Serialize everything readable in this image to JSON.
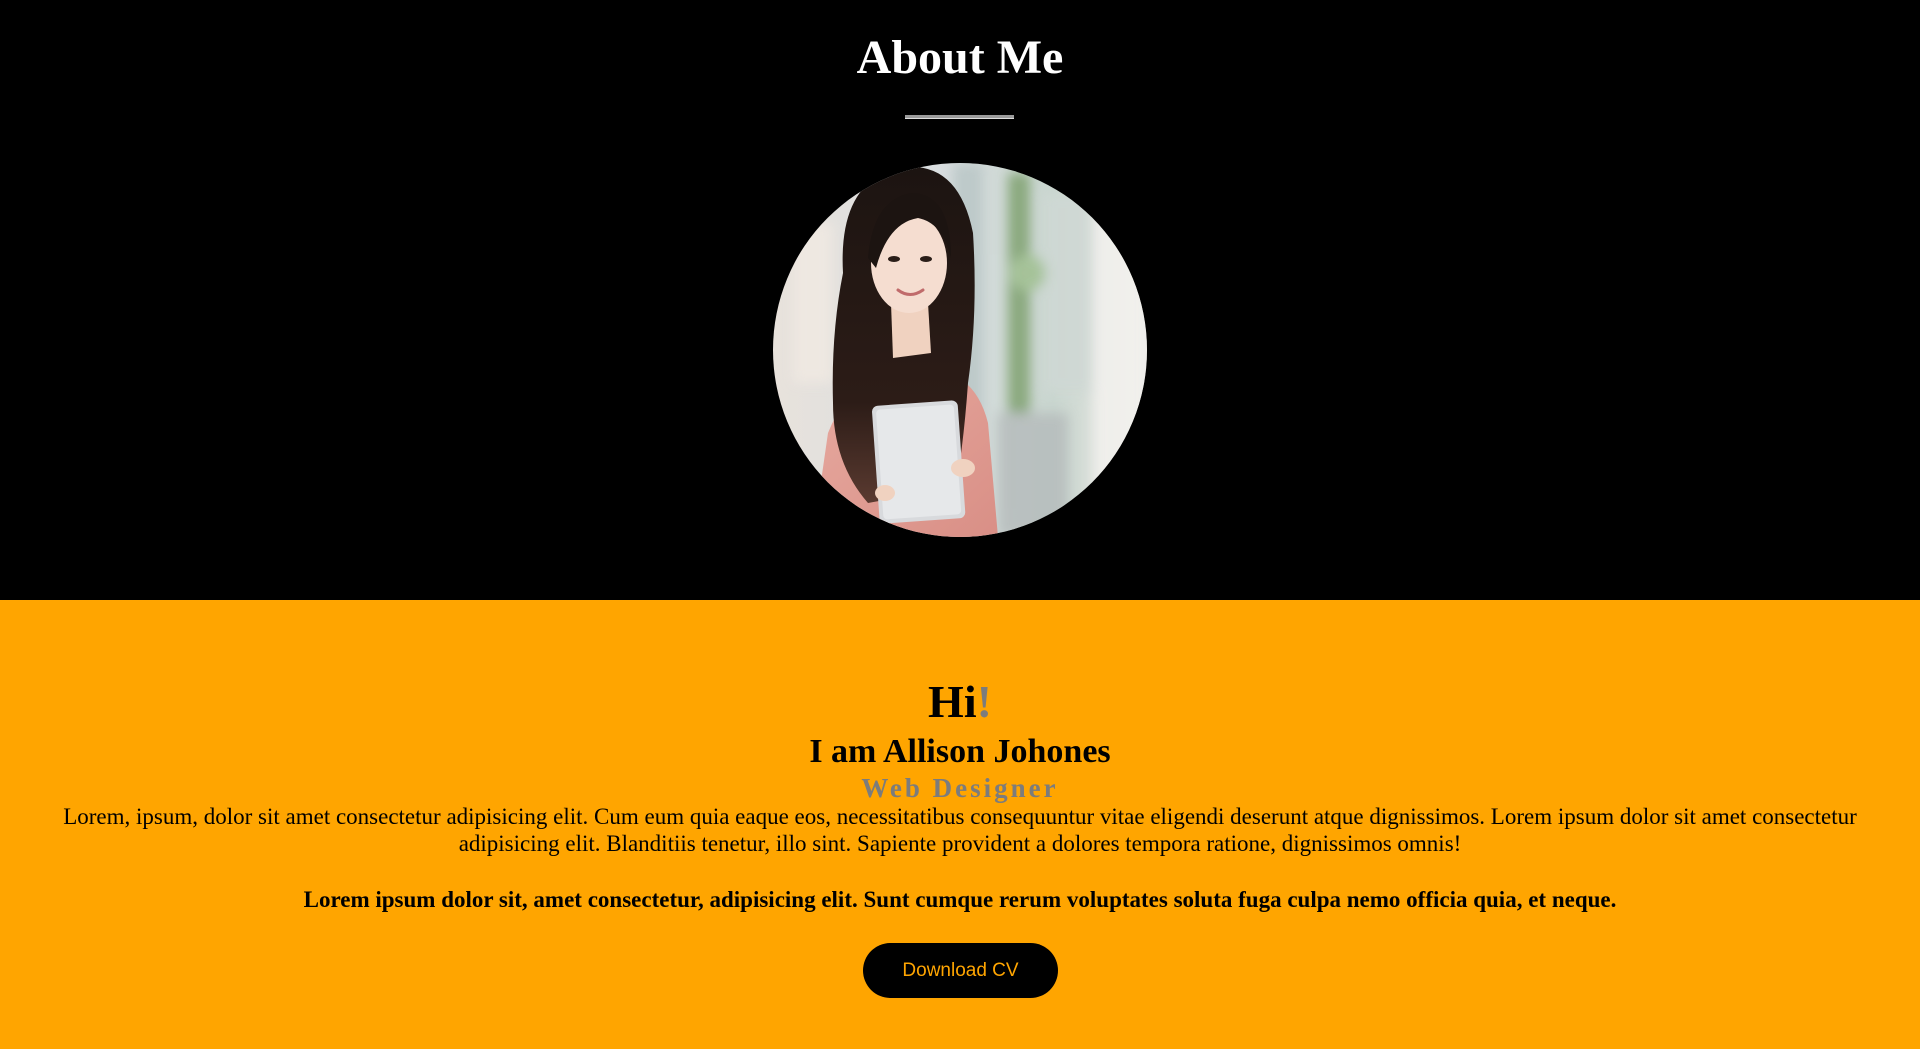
{
  "header": {
    "title": "About Me"
  },
  "profile": {
    "image_alt": "Portrait of a woman holding a laptop"
  },
  "intro": {
    "greeting": "Hi",
    "greeting_accent": "!",
    "name": "I am Allison Johones",
    "role": "Web Designer",
    "description": "Lorem, ipsum, dolor sit amet consectetur adipisicing elit. Cum eum quia eaque eos, necessitatibus consequuntur vitae eligendi deserunt atque dignissimos. Lorem ipsum dolor sit amet consectetur adipisicing elit. Blanditiis tenetur, illo sint. Sapiente provident a dolores tempora ratione, dignissimos omnis!",
    "tagline": "Lorem ipsum dolor sit, amet consectetur, adipisicing elit. Sunt cumque rerum voluptates soluta fuga culpa nemo officia quia, et neque."
  },
  "actions": {
    "download_label": "Download CV"
  },
  "colors": {
    "top_background": "#000000",
    "bottom_background": "#ffa500",
    "accent_gray": "#7c7c7c",
    "button_background": "#000000",
    "button_text": "#ffa500"
  }
}
